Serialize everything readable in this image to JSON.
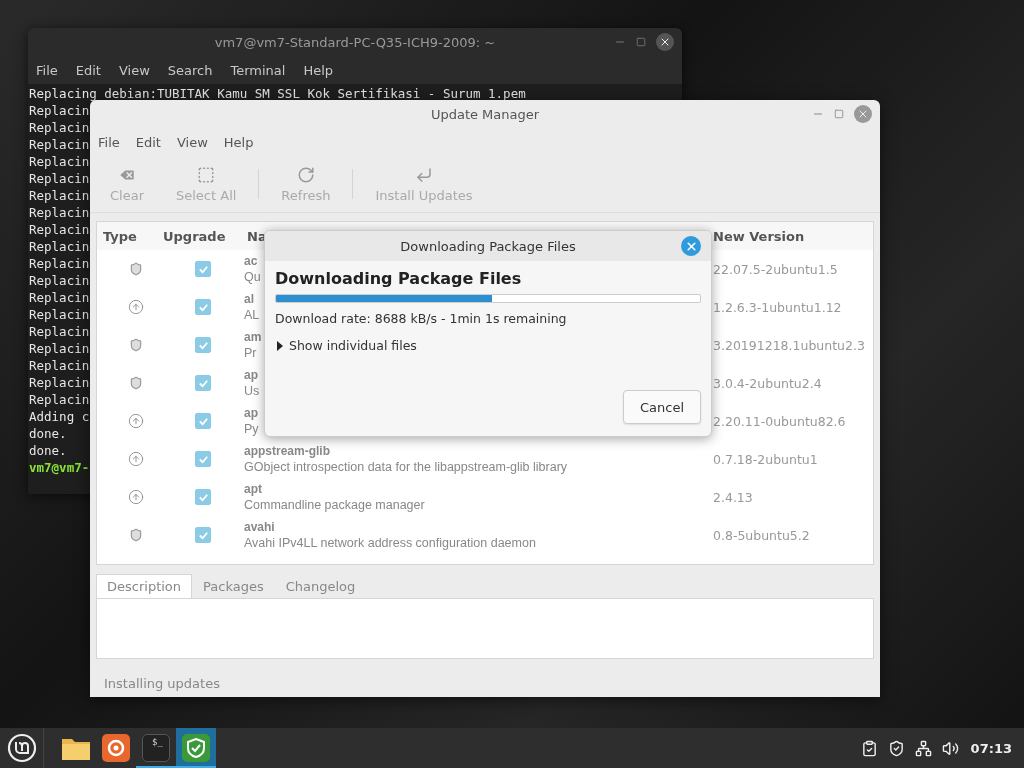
{
  "terminal": {
    "title": "vm7@vm7-Standard-PC-Q35-ICH9-2009: ~",
    "menu": [
      "File",
      "Edit",
      "View",
      "Search",
      "Terminal",
      "Help"
    ],
    "lines": [
      {
        "kind": "output",
        "text": "Replacing debian:TUBITAK Kamu SM SSL Kok Sertifikasi - Surum 1.pem"
      },
      {
        "kind": "output",
        "text": "Replacin"
      },
      {
        "kind": "output",
        "text": "Replacin"
      },
      {
        "kind": "output",
        "text": "Replacin"
      },
      {
        "kind": "output",
        "text": "Replacin"
      },
      {
        "kind": "output",
        "text": "Replacin"
      },
      {
        "kind": "output",
        "text": "Replacin"
      },
      {
        "kind": "output",
        "text": "Replacin"
      },
      {
        "kind": "output",
        "text": "Replacin"
      },
      {
        "kind": "output",
        "text": "Replacin"
      },
      {
        "kind": "output",
        "text": "Replacin"
      },
      {
        "kind": "output",
        "text": "Replacin"
      },
      {
        "kind": "output",
        "text": "Replacin"
      },
      {
        "kind": "output",
        "text": "Replacin"
      },
      {
        "kind": "output",
        "text": "Replacin"
      },
      {
        "kind": "output",
        "text": "Replacin"
      },
      {
        "kind": "output",
        "text": "Replacin"
      },
      {
        "kind": "output",
        "text": "Replacin"
      },
      {
        "kind": "output",
        "text": "Replacin"
      },
      {
        "kind": "output",
        "text": "Adding c"
      },
      {
        "kind": "output",
        "text": "done."
      },
      {
        "kind": "output",
        "text": "done."
      },
      {
        "kind": "prompt",
        "text": "vm7@vm7-"
      }
    ]
  },
  "update_manager": {
    "title": "Update Manager",
    "menu": [
      "File",
      "Edit",
      "View",
      "Help"
    ],
    "toolbar": [
      {
        "kind": "clear",
        "label": "Clear",
        "disabled": true
      },
      {
        "kind": "select",
        "label": "Select All",
        "disabled": true
      },
      {
        "kind": "refresh",
        "label": "Refresh",
        "disabled": true
      },
      {
        "kind": "install",
        "label": "Install Updates",
        "disabled": true
      }
    ],
    "table": {
      "columns": [
        "Type",
        "Upgrade",
        "Na",
        "New Version"
      ],
      "rows": [
        {
          "kind": "security",
          "checked": true,
          "name": "ac",
          "description": "Qu",
          "version": "22.07.5-2ubuntu1.5"
        },
        {
          "kind": "package",
          "checked": true,
          "name": "al",
          "description": "AL",
          "version": "1.2.6.3-1ubuntu1.12"
        },
        {
          "kind": "security",
          "checked": true,
          "name": "am",
          "description": "Pr",
          "version": "3.20191218.1ubuntu2.3"
        },
        {
          "kind": "security",
          "checked": true,
          "name": "ap",
          "description": "Us",
          "version": "3.0.4-2ubuntu2.4"
        },
        {
          "kind": "package",
          "checked": true,
          "name": "ap",
          "description": "Py",
          "version": "2.20.11-0ubuntu82.6"
        },
        {
          "kind": "package",
          "checked": true,
          "name": "appstream-glib",
          "description": "GObject introspection data for the libappstream-glib library",
          "version": "0.7.18-2ubuntu1"
        },
        {
          "kind": "package",
          "checked": true,
          "name": "apt",
          "description": "Commandline package manager",
          "version": "2.4.13"
        },
        {
          "kind": "security",
          "checked": true,
          "name": "avahi",
          "description": "Avahi IPv4LL network address configuration daemon",
          "version": "0.8-5ubuntu5.2"
        }
      ]
    },
    "tabs": [
      {
        "label": "Description",
        "selected": true
      },
      {
        "label": "Packages",
        "selected": false
      },
      {
        "label": "Changelog",
        "selected": false
      }
    ],
    "status_bar": "Installing updates"
  },
  "dialog": {
    "title": "Downloading Package Files",
    "heading": "Downloading Package Files",
    "progress": {
      "level": 0.51
    },
    "rate": "Download rate: 8688 kB/s - 1min 1s remaining",
    "expander": {
      "label": "Show individual files",
      "expanded": false
    },
    "buttons": [
      "Cancel"
    ]
  },
  "taskbar": {
    "apps": [
      {
        "kind": "files",
        "running": false,
        "selected": false
      },
      {
        "kind": "browser",
        "running": false,
        "selected": false
      },
      {
        "kind": "terminal",
        "glyph": "$_",
        "running": true,
        "selected": false
      },
      {
        "kind": "shield",
        "running": true,
        "selected": true
      }
    ],
    "tray": [
      {
        "kind": "notification"
      },
      {
        "kind": "shield"
      },
      {
        "kind": "network"
      },
      {
        "kind": "volume"
      }
    ],
    "clock": "07:13"
  }
}
